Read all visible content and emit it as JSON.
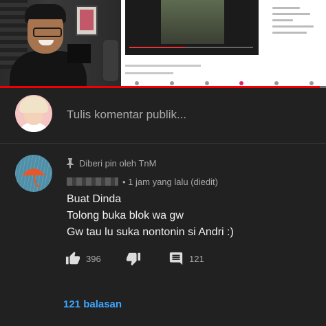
{
  "video": {
    "progress_fraction": 0.98
  },
  "add_comment": {
    "placeholder": "Tulis komentar publik..."
  },
  "comment": {
    "pinned_label": "Diberi pin oleh TnM",
    "timestamp": "1 jam yang lalu (diedit)",
    "lines": [
      "Buat Dinda",
      "Tolong buka blok wa gw",
      "Gw tau lu suka nontonin si Andri :)"
    ],
    "like_count": "396",
    "reply_count": "121",
    "replies_link": "121 balasan"
  },
  "icons": {
    "pin": "pin-icon",
    "like": "thumb-up-icon",
    "dislike": "thumb-down-icon",
    "reply": "comment-icon"
  },
  "colors": {
    "background": "#212121",
    "link": "#3ea6ff",
    "secondary_text": "#aaaaaa",
    "progress": "#ee0000"
  }
}
